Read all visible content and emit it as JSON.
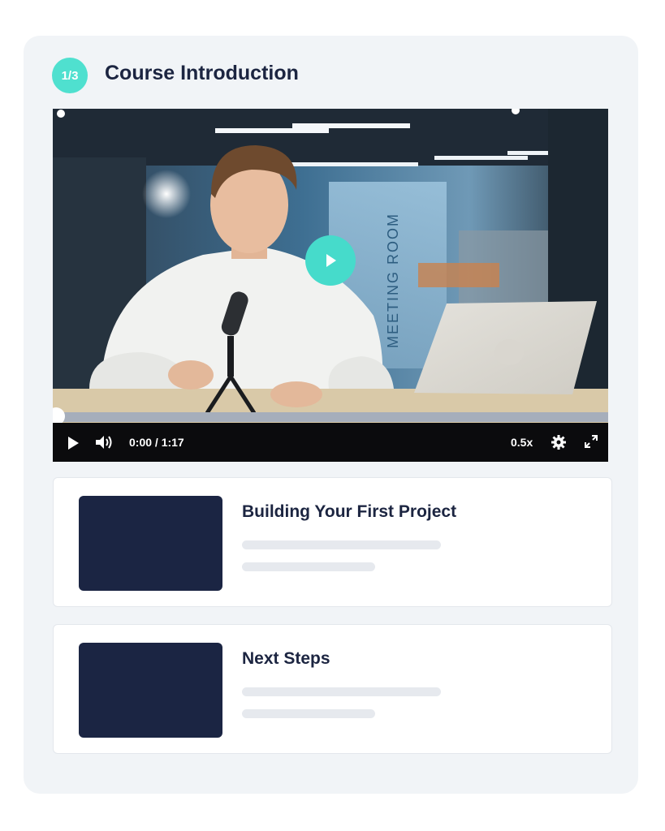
{
  "header": {
    "step": "1/3",
    "title": "Course Introduction"
  },
  "video": {
    "scene_sign": "MEETING ROOM",
    "time": "0:00 / 1:17",
    "speed": "0.5x",
    "progress": 0
  },
  "lessons": [
    {
      "title": "Building Your First Project"
    },
    {
      "title": "Next Steps"
    }
  ]
}
